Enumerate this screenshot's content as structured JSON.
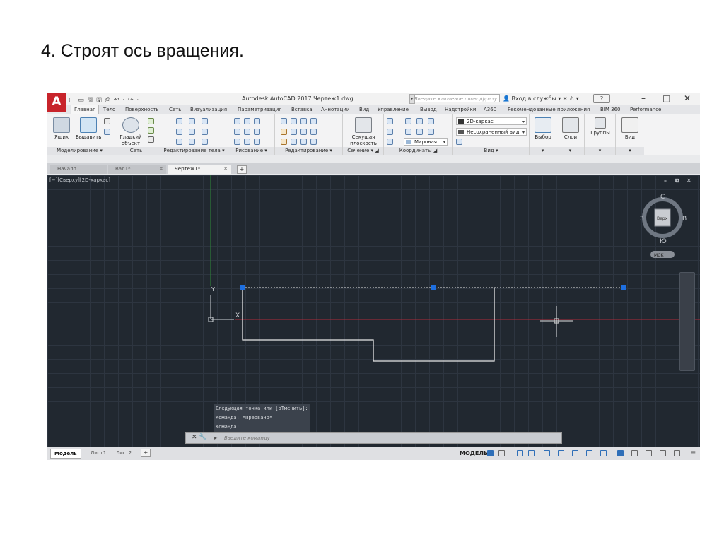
{
  "slide": {
    "title": "4. Строят ось вращения."
  },
  "app": {
    "logo": "A",
    "quick_access": "▢ ▭ 🖫 🖫 ⎙ ↶ · ↷ ·",
    "window_title": "Autodesk AutoCAD 2017   Чертеж1.dwg",
    "search_placeholder": "Введите ключевое слово/фразу",
    "sign_in": "Вход в службы",
    "help": "?",
    "window_buttons": [
      "–",
      "□",
      "✕"
    ]
  },
  "ribbon_tabs": [
    "Главная",
    "Тело",
    "Поверхность",
    "Сеть",
    "Визуализация",
    "Параметризация",
    "Вставка",
    "Аннотации",
    "Вид",
    "Управление",
    "Вывод",
    "Надстройки",
    "А360",
    "Рекомендованные приложения",
    "BIM 360",
    "Performance"
  ],
  "panels": {
    "modeling": {
      "label": "Моделирование",
      "btn1": "Ящик",
      "btn2": "Выдавить"
    },
    "mesh": {
      "label": "Сеть",
      "btn": "Гладкий объект"
    },
    "solid_edit": {
      "label": "Редактирование тела"
    },
    "draw": {
      "label": "Рисование"
    },
    "modify": {
      "label": "Редактирование"
    },
    "section": {
      "label": "Сечение",
      "btn": "Секущая плоскость"
    },
    "coords": {
      "label": "Координаты",
      "combo": "Мировая"
    },
    "view": {
      "label": "Вид",
      "combo1": "2D-каркас",
      "combo2": "Несохраненный вид"
    },
    "select": {
      "btn": "Выбор"
    },
    "layers": {
      "btn": "Слои"
    },
    "groups": {
      "btn": "Группы"
    },
    "view2": {
      "btn": "Вид"
    }
  },
  "file_tabs": [
    {
      "label": "Начало"
    },
    {
      "label": "Вал1*"
    },
    {
      "label": "Чертеж1*"
    }
  ],
  "viewport": {
    "label": "[−][Сверху][2D-каркас]",
    "controls": [
      "–",
      "⧉",
      "✕"
    ],
    "viewcube": {
      "n": "С",
      "s": "Ю",
      "w": "З",
      "e": "В",
      "top": "Верх",
      "wcs": "МСК"
    },
    "ucs_y": "Y",
    "ucs_x": "X"
  },
  "command": {
    "history": [
      "Следующая точка или [оТменить]:",
      "Команда: *Прервано*",
      "Команда:"
    ],
    "placeholder": "Введите команду"
  },
  "layout_tabs": [
    "Модель",
    "Лист1",
    "Лист2"
  ],
  "status": {
    "model": "МОДЕЛЬ"
  },
  "colors": {
    "background": "#212830",
    "grid": "#2d3540",
    "profile_line": "#e8e8e8",
    "grip": "#1e6fe0",
    "axis_x": "#b02a3a",
    "axis_y": "#2e8b3a"
  }
}
